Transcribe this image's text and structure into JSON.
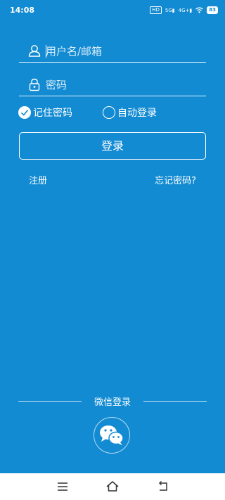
{
  "status_bar": {
    "time": "14:08",
    "hd_label": "HD",
    "net1": "5G",
    "net2": "4G+",
    "battery": "83"
  },
  "login_form": {
    "username_placeholder": "用户名/邮箱",
    "password_placeholder": "密码",
    "remember_label": "记住密码",
    "remember_checked": true,
    "auto_login_label": "自动登录",
    "auto_login_checked": false,
    "login_button_label": "登录",
    "register_link": "注册",
    "forgot_link": "忘记密码?"
  },
  "wechat": {
    "title": "微信登录",
    "icon": "wechat-icon"
  },
  "nav_bar": {
    "icons": [
      "menu-icon",
      "home-icon",
      "back-icon"
    ]
  },
  "colors": {
    "background": "#128bd3",
    "foreground": "#ffffff"
  }
}
